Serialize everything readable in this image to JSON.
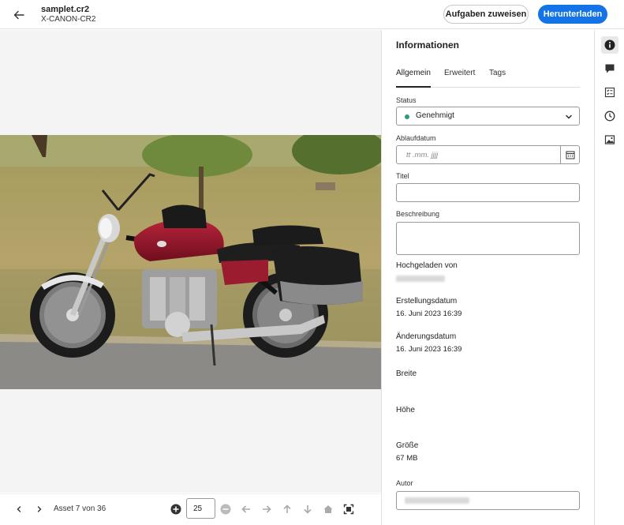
{
  "header": {
    "file_name": "samplet.cr2",
    "file_type": "X-CANON-CR2",
    "assign_label": "Aufgaben zuweisen",
    "download_label": "Herunterladen"
  },
  "footer": {
    "asset_count": "Asset 7 von 36",
    "zoom_value": "25"
  },
  "panel": {
    "title": "Informationen",
    "tabs": [
      {
        "label": "Allgemein"
      },
      {
        "label": "Erweitert"
      },
      {
        "label": "Tags"
      }
    ],
    "status": {
      "label": "Status",
      "value": "Genehmigt",
      "color": "#2d9d78"
    },
    "expiry": {
      "label": "Ablaufdatum",
      "placeholder": "tt .mm. jjjj"
    },
    "title_field": {
      "label": "Titel",
      "value": ""
    },
    "description": {
      "label": "Beschreibung",
      "value": ""
    },
    "uploaded_by": {
      "label": "Hochgeladen von"
    },
    "created": {
      "label": "Erstellungsdatum",
      "value": "16. Juni 2023 16:39"
    },
    "modified": {
      "label": "Änderungsdatum",
      "value": "16. Juni 2023 16:39"
    },
    "width": {
      "label": "Breite",
      "value": ""
    },
    "height": {
      "label": "Höhe",
      "value": ""
    },
    "size": {
      "label": "Größe",
      "value": "67 MB"
    },
    "author": {
      "label": "Autor"
    }
  },
  "rail": {
    "icons": [
      "info-icon",
      "comment-icon",
      "checklist-icon",
      "history-icon",
      "image-icon"
    ]
  },
  "colors": {
    "accent": "#1473e6",
    "approved": "#2d9d78"
  }
}
